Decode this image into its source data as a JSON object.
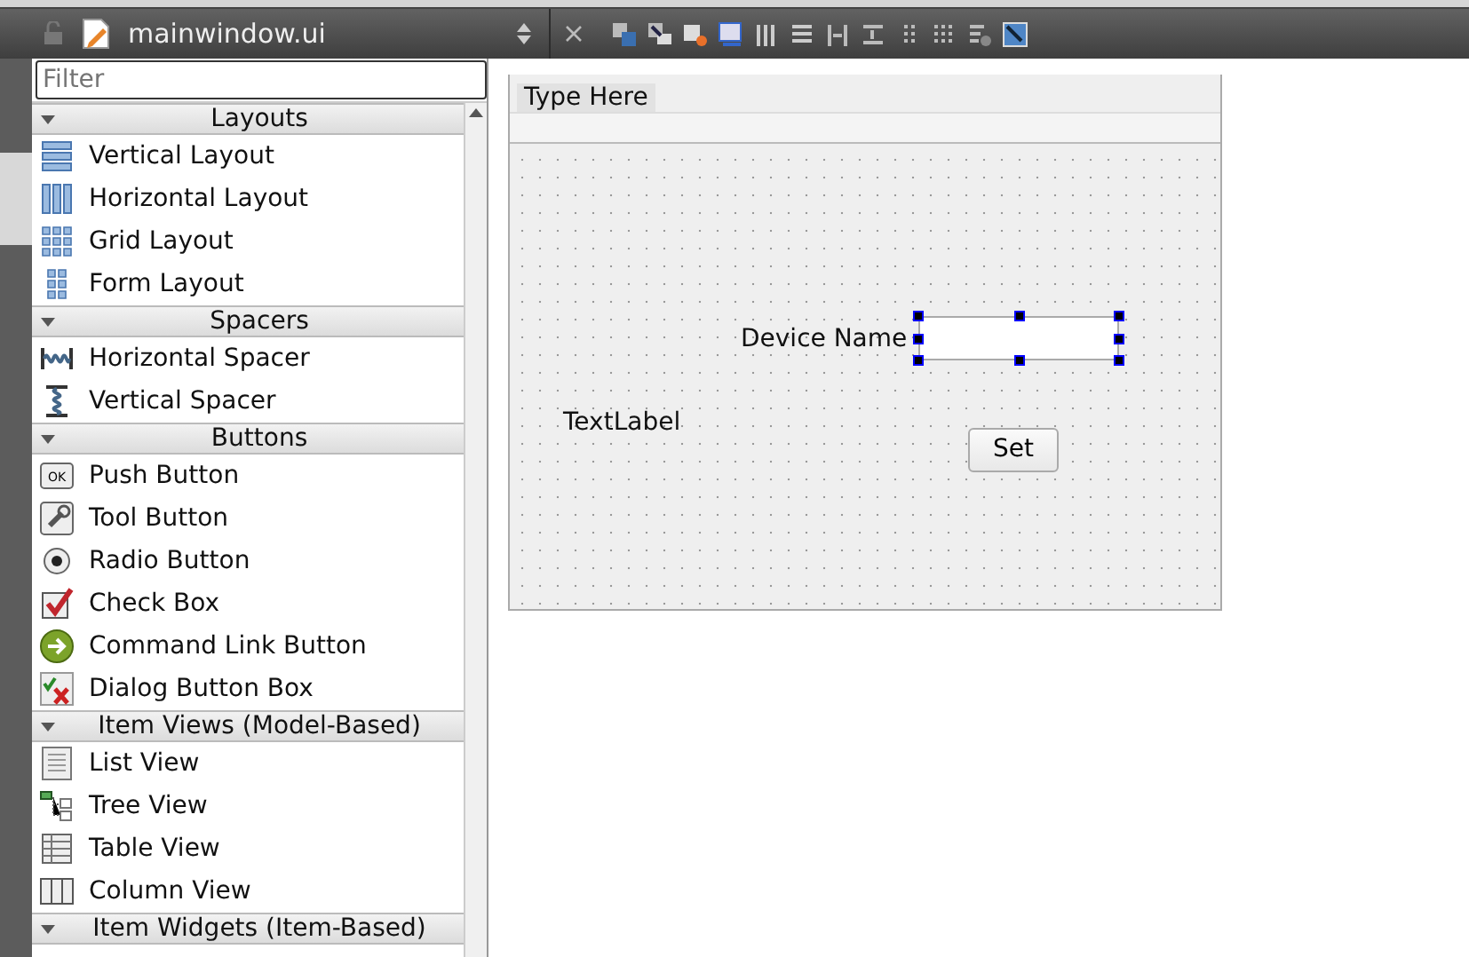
{
  "editor": {
    "file_name": "mainwindow.ui"
  },
  "widget_box": {
    "filter_placeholder": "Filter",
    "categories": [
      {
        "title": "Layouts",
        "expanded": true,
        "items": [
          {
            "label": "Vertical Layout",
            "kind": "vlayout"
          },
          {
            "label": "Horizontal Layout",
            "kind": "hlayout"
          },
          {
            "label": "Grid Layout",
            "kind": "grid"
          },
          {
            "label": "Form Layout",
            "kind": "form"
          }
        ]
      },
      {
        "title": "Spacers",
        "expanded": true,
        "items": [
          {
            "label": "Horizontal Spacer",
            "kind": "hspacer"
          },
          {
            "label": "Vertical Spacer",
            "kind": "vspacer"
          }
        ]
      },
      {
        "title": "Buttons",
        "expanded": true,
        "items": [
          {
            "label": "Push Button",
            "kind": "push",
            "icon_text": "OK"
          },
          {
            "label": "Tool Button",
            "kind": "tool"
          },
          {
            "label": "Radio Button",
            "kind": "radio"
          },
          {
            "label": "Check Box",
            "kind": "check"
          },
          {
            "label": "Command Link Button",
            "kind": "command"
          },
          {
            "label": "Dialog Button Box",
            "kind": "dialog"
          }
        ]
      },
      {
        "title": "Item Views (Model-Based)",
        "expanded": true,
        "items": [
          {
            "label": "List View",
            "kind": "list"
          },
          {
            "label": "Tree View",
            "kind": "tree"
          },
          {
            "label": "Table View",
            "kind": "table"
          },
          {
            "label": "Column View",
            "kind": "column"
          }
        ]
      },
      {
        "title": "Item Widgets (Item-Based)",
        "expanded": true
      }
    ]
  },
  "form": {
    "menu_placeholder": "Type Here",
    "widgets": [
      {
        "kind": "label",
        "text": "Device Name"
      },
      {
        "kind": "line_edit",
        "selected": true
      },
      {
        "kind": "label",
        "text": "TextLabel"
      },
      {
        "kind": "button",
        "text": "Set"
      }
    ]
  }
}
